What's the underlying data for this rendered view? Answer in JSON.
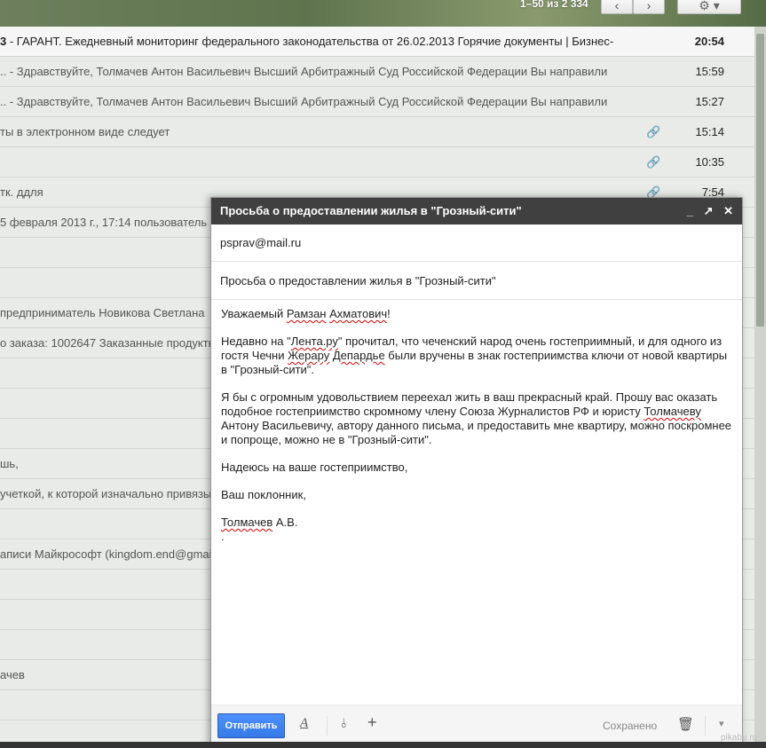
{
  "toolbar": {
    "pager_text": "1–50 из 2 334",
    "prev_label": "‹",
    "next_label": "›",
    "settings_icon": "gear-icon",
    "settings_label": "⚙ ▾"
  },
  "email_list": [
    {
      "snippet_bold": "3",
      "snippet": " - ГАРАНТ. Ежедневный мониторинг федерального законодательства от 26.02.2013 Горячие документы | Бизнес-",
      "time": "20:54",
      "unread": true,
      "attachment": false
    },
    {
      "snippet_bold": "",
      "snippet": ".. - Здравствуйте, Толмачев Антон Васильевич Высший Арбитражный Суд Российской Федерации Вы направили",
      "time": "15:59",
      "unread": false,
      "attachment": false
    },
    {
      "snippet_bold": "",
      "snippet": ".. - Здравствуйте, Толмачев Антон Васильевич Высший Арбитражный Суд Российской Федерации Вы направили",
      "time": "15:27",
      "unread": false,
      "attachment": false
    },
    {
      "snippet_bold": "",
      "snippet": "ты в электронном виде следует",
      "time": "15:14",
      "unread": false,
      "attachment": true
    },
    {
      "snippet_bold": "",
      "snippet": "",
      "time": "10:35",
      "unread": false,
      "attachment": true
    },
    {
      "snippet_bold": "",
      "snippet": " тк. ддля",
      "time": "7:54",
      "unread": false,
      "attachment": true
    },
    {
      "snippet_bold": "",
      "snippet": "5 февраля 2013 г., 17:14 пользователь",
      "time": "",
      "unread": false,
      "attachment": false
    },
    {
      "snippet_bold": "",
      "snippet": "",
      "time": "",
      "unread": false,
      "attachment": false
    },
    {
      "snippet_bold": "",
      "snippet": "",
      "time": "",
      "unread": false,
      "attachment": false
    },
    {
      "snippet_bold": "",
      "snippet": " предприниматель Новикова Светлана",
      "time": "",
      "unread": false,
      "attachment": false
    },
    {
      "snippet_bold": "",
      "snippet": "о заказа: 1002647 Заказанные продукты",
      "time": "",
      "unread": false,
      "attachment": false
    },
    {
      "snippet_bold": "",
      "snippet": "",
      "time": "",
      "unread": false,
      "attachment": false
    },
    {
      "snippet_bold": "",
      "snippet": "",
      "time": "",
      "unread": false,
      "attachment": false
    },
    {
      "snippet_bold": "",
      "snippet": "",
      "time": "",
      "unread": false,
      "attachment": false
    },
    {
      "snippet_bold": "",
      "snippet": "шь,",
      "time": "",
      "unread": false,
      "attachment": false
    },
    {
      "snippet_bold": "",
      "snippet": " учеткой, к которой изначально привязы",
      "time": "",
      "unread": false,
      "attachment": false
    },
    {
      "snippet_bold": "",
      "snippet": "",
      "time": "",
      "unread": false,
      "attachment": false
    },
    {
      "snippet_bold": "",
      "snippet": "аписи Майкрософт (kingdom.end@gmail.",
      "time": "",
      "unread": false,
      "attachment": false
    },
    {
      "snippet_bold": "",
      "snippet": "",
      "time": "",
      "unread": false,
      "attachment": false
    },
    {
      "snippet_bold": "",
      "snippet": "",
      "time": "",
      "unread": false,
      "attachment": false
    },
    {
      "snippet_bold": "",
      "snippet": "",
      "time": "",
      "unread": false,
      "attachment": false
    },
    {
      "snippet_bold": "",
      "snippet": "ачев",
      "time": "",
      "unread": false,
      "attachment": false
    },
    {
      "snippet_bold": "",
      "snippet": "",
      "time": "",
      "unread": false,
      "attachment": false
    }
  ],
  "compose": {
    "title": "Просьба о предоставлении жилья в \"Грозный-сити\"",
    "minimize_label": "_",
    "popout_label": "↗",
    "close_label": "✕",
    "to": "psprav@mail.ru",
    "subject": "Просьба о предоставлении жилья в \"Грозный-сити\"",
    "body": {
      "greeting_pre": "Уважаемый ",
      "greeting_name1": "Рамзан",
      "greeting_space": " ",
      "greeting_name2": "Ахматович",
      "greeting_post": "!",
      "p1_a": "Недавно на \"",
      "p1_lenta": "Лента.ру",
      "p1_b": "\" прочитал, что чеченский народ очень гостеприимный, и для одного из гостя Чечни ",
      "p1_zherar": "Жерару",
      "p1_space": " ",
      "p1_depardie": "Депардье",
      "p1_c": " были вручены в знак гостеприимства ключи от новой квартиры в \"Грозный-сити\".",
      "p2_a": "Я бы с огромным удовольствием переехал жить в ваш прекрасный край. Прошу вас оказать подобное гостеприимство скромному члену Союза Журналистов РФ и юристу ",
      "p2_tolm": "Толмачеву",
      "p2_b": " Антону Васильевичу, автору данного письма, и предоставить мне квартиру, можно поскромнее и попроще, можно не в \"Грозный-сити\".",
      "p3": "Надеюсь на ваше гостеприимство,",
      "p4": "Ваш поклонник,",
      "sig_name": "Толмачев",
      "sig_rest": " А.В.",
      "sig_dot": "."
    },
    "send_label": "Отправить",
    "format_icon": "text-format-icon",
    "format_label": "A",
    "attach_icon": "paperclip-icon",
    "attach_label": "⫰",
    "plus_label": "+",
    "saved_label": "Сохранено",
    "trash_label": "🗑",
    "more_label": "▾"
  },
  "watermark": "pikabu.ru",
  "colors": {
    "send_button": "#4d90fe",
    "compose_header": "#404040"
  }
}
